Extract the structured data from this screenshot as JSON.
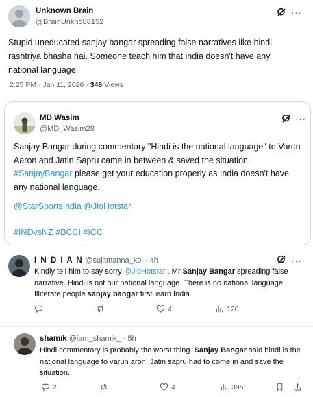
{
  "main_post": {
    "author_name": "Unknown Brain",
    "author_handle": "@BrainUnkno88152",
    "text": "Stupid uneducated sanjay bangar spreading false narratives like hindi rashtriya bhasha hai. Someone teach him that india doesn't have any national language",
    "time": "2:25 PM · Jan 11, 2026 · ",
    "views_count": "346",
    "views_label": " Views"
  },
  "quoted_post": {
    "author_name": "MD Wasim",
    "author_handle": "@MD_Wasim28",
    "text_1": "Sanjay Bangar during commentary \"Hindi is the national language\" to Varon Aaron and Jatin Sapru came in between & saved the situation. ",
    "hashtag_1": "#SanjayBangar",
    "text_2": " please get your education properly as India doesn't have any national language.",
    "mentions": "@StarSportsIndia @JioHotstar",
    "hashtags": "#INDvsNZ #BCCI #ICC"
  },
  "reply_1": {
    "author_name": "I N D I A N",
    "author_handle": "@sujitmanna_kol",
    "time": " · 4h",
    "t1": "Kindly tell him to say sorry ",
    "mention": "@JioHotstar",
    "t2": " . Mr ",
    "b1": "Sanjay Bangar",
    "t3": " spreading false narrative. Hindi is not our national language. There is no national language. Illiterate people ",
    "b2": "sanjay bangar",
    "t4": " first learn India.",
    "reply_count": "",
    "repost_count": "",
    "like_count": "4",
    "view_count": "120"
  },
  "reply_2": {
    "author_name": "shamik",
    "author_handle": "@iam_shamik_",
    "time": " · 5h",
    "t1": "Hindi commentary is probably the worst thing. ",
    "b1": "Sanjay Bangar",
    "t2": " said hindi is the national language to varun aron. Jatin sapru had to come in and save the situation.",
    "reply_count": "2",
    "repost_count": "",
    "like_count": "4",
    "view_count": "395"
  },
  "icons": [
    "grok-icon",
    "more-icon",
    "reply-icon",
    "repost-icon",
    "like-icon",
    "views-icon",
    "bookmark-icon",
    "share-icon"
  ],
  "colors": {
    "link": "#1d9bf0",
    "muted": "#536471",
    "text": "#0f1419",
    "border": "#cfd9de"
  }
}
